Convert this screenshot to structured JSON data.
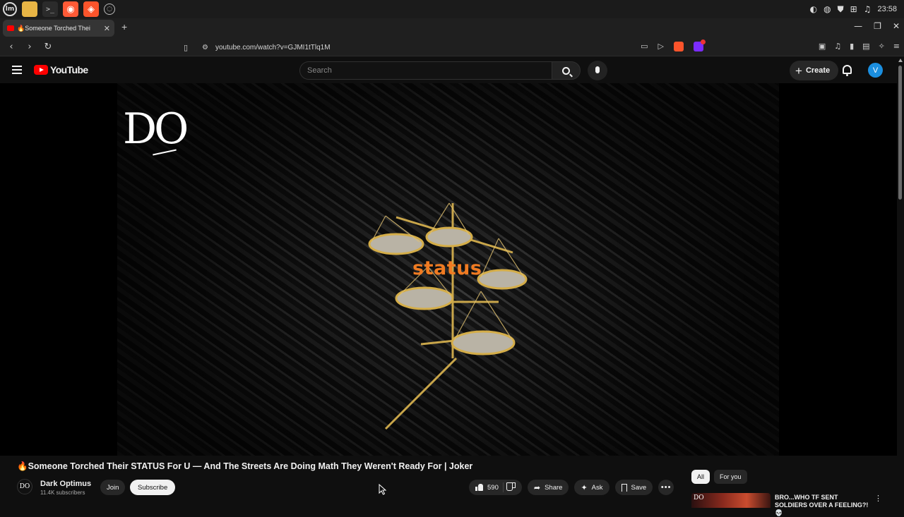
{
  "os_taskbar": {
    "apps": [
      {
        "name": "menu",
        "glyph": "lm"
      },
      {
        "name": "files",
        "glyph": ""
      },
      {
        "name": "terminal",
        "glyph": ">_"
      },
      {
        "name": "browser-dev",
        "glyph": "◉"
      },
      {
        "name": "brave",
        "glyph": "◈"
      },
      {
        "name": "misc",
        "glyph": "◌"
      }
    ],
    "tray_icons": [
      "◐",
      "◍",
      "⛊",
      "⊞",
      "♫"
    ],
    "clock": "23:58"
  },
  "browser": {
    "tab_title": "🔥Someone Torched Thei",
    "tab_close": "✕",
    "new_tab": "+",
    "window_controls": [
      "—",
      "❐",
      "✕"
    ],
    "nav": {
      "back": "‹",
      "forward": "›",
      "reload": "↻"
    },
    "url": "youtube.com/watch?v=GJMI1tTlq1M",
    "url_icons": [
      "▭",
      "▷"
    ],
    "toolbar_icons": [
      "▣",
      "♫",
      "▮",
      "▤",
      "✧",
      "≡"
    ]
  },
  "youtube_header": {
    "logo_text": "YouTube",
    "search_placeholder": "Search",
    "create_label": "Create",
    "create_plus": "+",
    "avatar_letter": "V"
  },
  "video": {
    "brand_mark": "DO",
    "caption": "status"
  },
  "details": {
    "title": "🔥Someone Torched Their STATUS For U — And The Streets Are Doing Math They Weren't Ready For | Joker",
    "channel_avatar": "DO",
    "channel_name": "Dark Optimus",
    "subscribers": "11.4K subscribers",
    "join_label": "Join",
    "subscribe_label": "Subscribe",
    "likes": "590",
    "share_label": "Share",
    "ask_label": "Ask",
    "save_label": "Save",
    "more_label": "•••"
  },
  "sidebar": {
    "chips": [
      "All",
      "For you"
    ],
    "related_title": "BRO...WHO TF SENT SOLDIERS OVER A FEELING?! 💀",
    "related_thumb_mark": "DO",
    "related_more": "⋮"
  },
  "colors": {
    "background": "#0f0f0f",
    "youtube_red": "#ff0000",
    "caption_orange": "#f07b22",
    "avatar_blue": "#1b8fe0"
  }
}
